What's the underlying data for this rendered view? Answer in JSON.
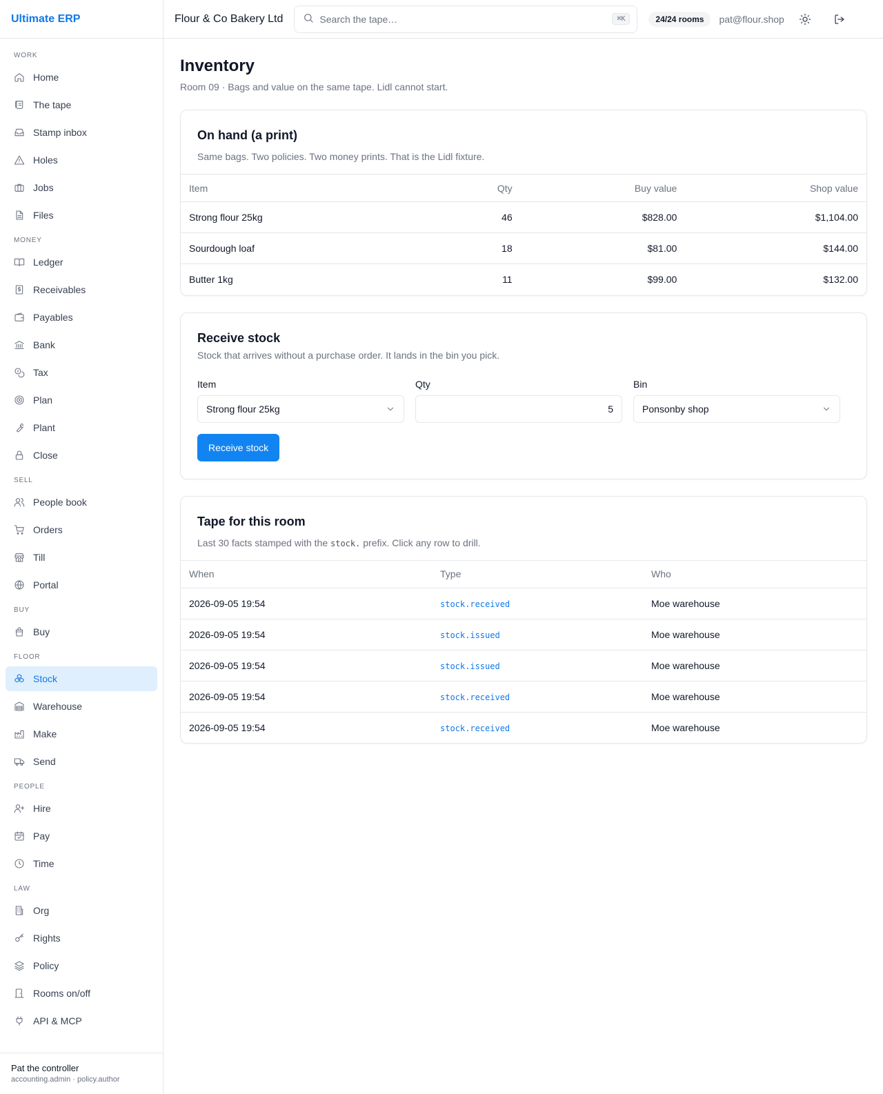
{
  "app": {
    "name": "Ultimate ERP"
  },
  "topbar": {
    "company": "Flour & Co Bakery Ltd",
    "search_placeholder": "Search the tape…",
    "search_shortcut": "⌘K",
    "rooms_badge": "24/24 rooms",
    "user_email": "pat@flour.shop"
  },
  "sidebar": {
    "sections": [
      {
        "label": "Work",
        "items": [
          {
            "label": "Home",
            "icon": "home-icon"
          },
          {
            "label": "The tape",
            "icon": "scroll-icon"
          },
          {
            "label": "Stamp inbox",
            "icon": "inbox-icon"
          },
          {
            "label": "Holes",
            "icon": "alert-triangle-icon"
          },
          {
            "label": "Jobs",
            "icon": "briefcase-icon"
          },
          {
            "label": "Files",
            "icon": "file-icon"
          }
        ]
      },
      {
        "label": "Money",
        "items": [
          {
            "label": "Ledger",
            "icon": "book-open-icon"
          },
          {
            "label": "Receivables",
            "icon": "receipt-icon"
          },
          {
            "label": "Payables",
            "icon": "wallet-icon"
          },
          {
            "label": "Bank",
            "icon": "bank-icon"
          },
          {
            "label": "Tax",
            "icon": "coins-icon"
          },
          {
            "label": "Plan",
            "icon": "target-icon"
          },
          {
            "label": "Plant",
            "icon": "wrench-icon"
          },
          {
            "label": "Close",
            "icon": "lock-icon"
          }
        ]
      },
      {
        "label": "Sell",
        "items": [
          {
            "label": "People book",
            "icon": "users-icon"
          },
          {
            "label": "Orders",
            "icon": "cart-icon"
          },
          {
            "label": "Till",
            "icon": "store-icon"
          },
          {
            "label": "Portal",
            "icon": "globe-icon"
          }
        ]
      },
      {
        "label": "Buy",
        "items": [
          {
            "label": "Buy",
            "icon": "shopping-bag-icon"
          }
        ]
      },
      {
        "label": "Floor",
        "items": [
          {
            "label": "Stock",
            "icon": "boxes-icon",
            "active": true
          },
          {
            "label": "Warehouse",
            "icon": "warehouse-icon"
          },
          {
            "label": "Make",
            "icon": "factory-icon"
          },
          {
            "label": "Send",
            "icon": "truck-icon"
          }
        ]
      },
      {
        "label": "People",
        "items": [
          {
            "label": "Hire",
            "icon": "user-plus-icon"
          },
          {
            "label": "Pay",
            "icon": "calendar-check-icon"
          },
          {
            "label": "Time",
            "icon": "clock-icon"
          }
        ]
      },
      {
        "label": "Law",
        "items": [
          {
            "label": "Org",
            "icon": "building-icon"
          },
          {
            "label": "Rights",
            "icon": "key-icon"
          },
          {
            "label": "Policy",
            "icon": "layers-icon"
          },
          {
            "label": "Rooms on/off",
            "icon": "door-icon"
          },
          {
            "label": "API & MCP",
            "icon": "plug-icon"
          }
        ]
      }
    ],
    "footer": {
      "name": "Pat the controller",
      "roles": "accounting.admin · policy.author"
    }
  },
  "page": {
    "title": "Inventory",
    "subtitle": "Room 09 · Bags and value on the same tape. Lidl cannot start."
  },
  "on_hand": {
    "title": "On hand (a print)",
    "description": "Same bags. Two policies. Two money prints. That is the Lidl fixture.",
    "columns": [
      "Item",
      "Qty",
      "Buy value",
      "Shop value"
    ],
    "rows": [
      [
        "Strong flour 25kg",
        "46",
        "$828.00",
        "$1,104.00"
      ],
      [
        "Sourdough loaf",
        "18",
        "$81.00",
        "$144.00"
      ],
      [
        "Butter 1kg",
        "11",
        "$99.00",
        "$132.00"
      ]
    ]
  },
  "receive": {
    "title": "Receive stock",
    "description": "Stock that arrives without a purchase order. It lands in the bin you pick.",
    "item_label": "Item",
    "item_value": "Strong flour 25kg",
    "qty_label": "Qty",
    "qty_value": "5",
    "bin_label": "Bin",
    "bin_value": "Ponsonby shop",
    "button": "Receive stock"
  },
  "tape": {
    "title": "Tape for this room",
    "desc_before": "Last 30 facts stamped with the",
    "desc_code": "stock.",
    "desc_after": "prefix. Click any row to drill.",
    "columns": [
      "When",
      "Type",
      "Who"
    ],
    "rows": [
      [
        "2026-09-05 19:54",
        "stock.received",
        "Moe warehouse"
      ],
      [
        "2026-09-05 19:54",
        "stock.issued",
        "Moe warehouse"
      ],
      [
        "2026-09-05 19:54",
        "stock.issued",
        "Moe warehouse"
      ],
      [
        "2026-09-05 19:54",
        "stock.received",
        "Moe warehouse"
      ],
      [
        "2026-09-05 19:54",
        "stock.received",
        "Moe warehouse"
      ]
    ]
  },
  "colors": {
    "accent": "#1078e8",
    "primary_button": "#1284f2",
    "active_nav_bg": "#e0effd"
  }
}
